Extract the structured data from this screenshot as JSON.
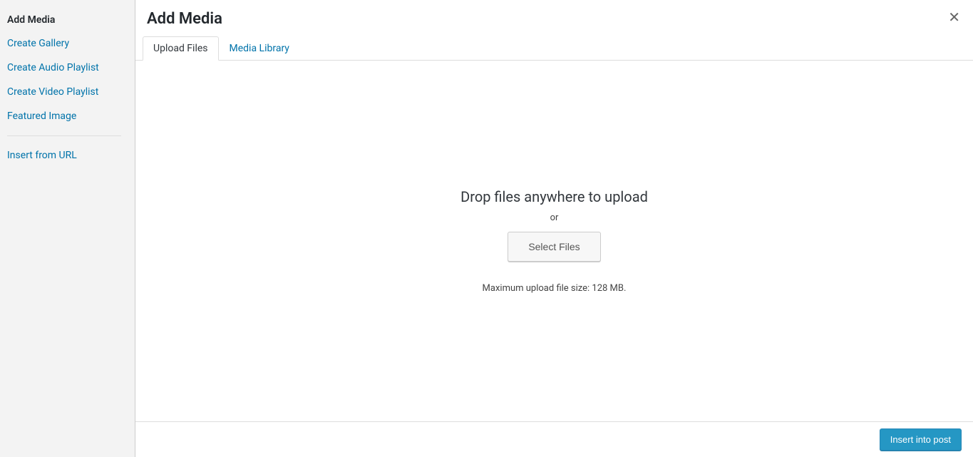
{
  "sidebar": {
    "active": "Add Media",
    "items": [
      "Create Gallery",
      "Create Audio Playlist",
      "Create Video Playlist",
      "Featured Image"
    ],
    "after_divider": "Insert from URL"
  },
  "header": {
    "title": "Add Media"
  },
  "tabs": {
    "upload": "Upload Files",
    "library": "Media Library"
  },
  "uploader": {
    "drop_text": "Drop files anywhere to upload",
    "or": "or",
    "select_button": "Select Files",
    "max_size": "Maximum upload file size: 128 MB."
  },
  "footer": {
    "insert_button": "Insert into post"
  }
}
